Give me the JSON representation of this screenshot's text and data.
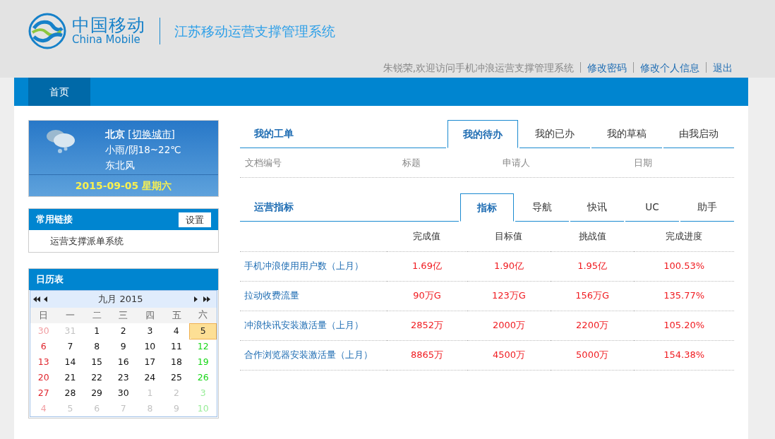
{
  "header": {
    "logo_cn": "中国移动",
    "logo_en": "China Mobile",
    "system_title": "江苏移动运营支撑管理系统",
    "welcome": "朱锐荣,欢迎访问手机冲浪运营支撑管理系统",
    "links": [
      "修改密码",
      "修改个人信息",
      "退出"
    ]
  },
  "nav": [
    {
      "label": "首页",
      "selected": true
    }
  ],
  "weather": {
    "city": "北京",
    "switch_link": "[切换城市]",
    "condition": "小雨/阴18~22℃",
    "wind": "东北风",
    "date": "2015-09-05 星期六"
  },
  "quick_links": {
    "title": "常用链接",
    "settings_button": "设置",
    "items": [
      "运营支撑派单系统"
    ]
  },
  "calendar": {
    "title": "日历表",
    "month_label": "九月 2015",
    "weekdays": [
      "日",
      "一",
      "二",
      "三",
      "四",
      "五",
      "六"
    ],
    "weeks": [
      [
        {
          "label": "30",
          "outside": true,
          "selected": false
        },
        {
          "label": "31",
          "outside": true,
          "selected": false
        },
        {
          "label": "1",
          "outside": false,
          "selected": false
        },
        {
          "label": "2",
          "outside": false,
          "selected": false
        },
        {
          "label": "3",
          "outside": false,
          "selected": false
        },
        {
          "label": "4",
          "outside": false,
          "selected": false
        },
        {
          "label": "5",
          "outside": false,
          "selected": true
        }
      ],
      [
        {
          "label": "6",
          "outside": false,
          "selected": false
        },
        {
          "label": "7",
          "outside": false,
          "selected": false
        },
        {
          "label": "8",
          "outside": false,
          "selected": false
        },
        {
          "label": "9",
          "outside": false,
          "selected": false
        },
        {
          "label": "10",
          "outside": false,
          "selected": false
        },
        {
          "label": "11",
          "outside": false,
          "selected": false
        },
        {
          "label": "12",
          "outside": false,
          "selected": false
        }
      ],
      [
        {
          "label": "13",
          "outside": false,
          "selected": false
        },
        {
          "label": "14",
          "outside": false,
          "selected": false
        },
        {
          "label": "15",
          "outside": false,
          "selected": false
        },
        {
          "label": "16",
          "outside": false,
          "selected": false
        },
        {
          "label": "17",
          "outside": false,
          "selected": false
        },
        {
          "label": "18",
          "outside": false,
          "selected": false
        },
        {
          "label": "19",
          "outside": false,
          "selected": false
        }
      ],
      [
        {
          "label": "20",
          "outside": false,
          "selected": false
        },
        {
          "label": "21",
          "outside": false,
          "selected": false
        },
        {
          "label": "22",
          "outside": false,
          "selected": false
        },
        {
          "label": "23",
          "outside": false,
          "selected": false
        },
        {
          "label": "24",
          "outside": false,
          "selected": false
        },
        {
          "label": "25",
          "outside": false,
          "selected": false
        },
        {
          "label": "26",
          "outside": false,
          "selected": false
        }
      ],
      [
        {
          "label": "27",
          "outside": false,
          "selected": false
        },
        {
          "label": "28",
          "outside": false,
          "selected": false
        },
        {
          "label": "29",
          "outside": false,
          "selected": false
        },
        {
          "label": "30",
          "outside": false,
          "selected": false
        },
        {
          "label": "1",
          "outside": true,
          "selected": false
        },
        {
          "label": "2",
          "outside": true,
          "selected": false
        },
        {
          "label": "3",
          "outside": true,
          "selected": false
        }
      ],
      [
        {
          "label": "4",
          "outside": true,
          "selected": false
        },
        {
          "label": "5",
          "outside": true,
          "selected": false
        },
        {
          "label": "6",
          "outside": true,
          "selected": false
        },
        {
          "label": "7",
          "outside": true,
          "selected": false
        },
        {
          "label": "8",
          "outside": true,
          "selected": false
        },
        {
          "label": "9",
          "outside": true,
          "selected": false
        },
        {
          "label": "10",
          "outside": true,
          "selected": false
        }
      ]
    ]
  },
  "work_orders": {
    "title": "我的工单",
    "tabs": [
      {
        "label": "我的待办",
        "selected": true
      },
      {
        "label": "我的已办",
        "selected": false
      },
      {
        "label": "我的草稿",
        "selected": false
      },
      {
        "label": "由我启动",
        "selected": false
      }
    ],
    "columns": [
      "文档编号",
      "标题",
      "申请人",
      "日期"
    ]
  },
  "indicators": {
    "title": "运营指标",
    "tabs": [
      {
        "label": "指标",
        "selected": true
      },
      {
        "label": "导航",
        "selected": false
      },
      {
        "label": "快讯",
        "selected": false
      },
      {
        "label": "UC",
        "selected": false
      },
      {
        "label": "助手",
        "selected": false
      }
    ],
    "columns": [
      "完成值",
      "目标值",
      "挑战值",
      "完成进度"
    ],
    "rows": [
      {
        "name": "手机冲浪使用用户数（上月）",
        "values": [
          "1.69亿",
          "1.90亿",
          "1.95亿",
          "100.53%"
        ]
      },
      {
        "name": "拉动收费流量",
        "values": [
          "90万G",
          "123万G",
          "156万G",
          "135.77%"
        ]
      },
      {
        "name": "冲浪快讯安装激活量（上月）",
        "values": [
          "2852万",
          "2000万",
          "2200万",
          "105.20%"
        ]
      },
      {
        "name": "合作浏览器安装激活量（上月）",
        "values": [
          "8865万",
          "4500万",
          "5000万",
          "154.38%"
        ]
      }
    ]
  }
}
